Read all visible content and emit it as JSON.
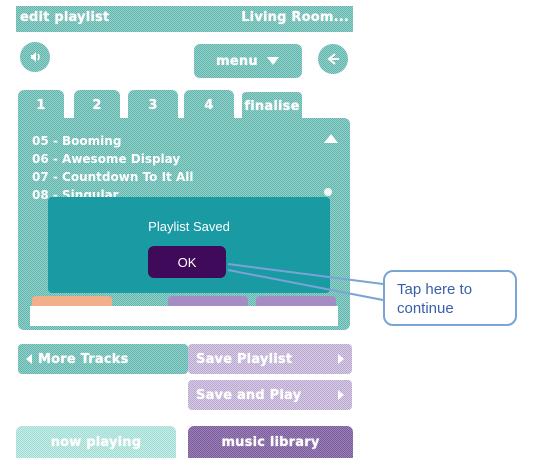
{
  "header": {
    "title": "edit playlist",
    "room": "Living Room..."
  },
  "toolbar": {
    "menu_label": "menu"
  },
  "tabs": [
    {
      "label": "1"
    },
    {
      "label": "2"
    },
    {
      "label": "3"
    },
    {
      "label": "4"
    },
    {
      "label": "finalise",
      "active": true
    }
  ],
  "tracks": [
    "05 - Booming",
    "06 - Awesome Display",
    "07 - Countdown To It All",
    "08 - Singular"
  ],
  "dialog": {
    "title": "Playlist Saved",
    "ok_label": "OK"
  },
  "actions": {
    "more_tracks": "More Tracks",
    "save_playlist": "Save Playlist",
    "save_and_play": "Save and Play"
  },
  "bottom_tabs": {
    "now_playing": "now playing",
    "music_library": "music library"
  },
  "callout": {
    "text": "Tap here to continue"
  },
  "colors": {
    "teal": "#5fb6ad",
    "dialog": "#1a9aa3",
    "ok_button": "#3f0a5a",
    "purple": "#b8a6cf",
    "callout_border": "#7aa3d6",
    "callout_text": "#3a5fa8"
  }
}
